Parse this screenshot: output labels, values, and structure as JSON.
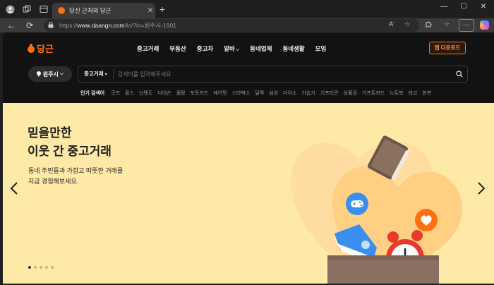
{
  "browser": {
    "tab_title": "당신 근처의 당근",
    "url_scheme": "https://",
    "url_host": "www.daangn.com",
    "url_path": "/kr/?in=원주시-1901",
    "newtab_glyph": "+",
    "back_glyph": "←",
    "reload_glyph": "⟳",
    "minimize_glyph": "—",
    "maximize_glyph": "☐",
    "close_glyph": "✕",
    "more_glyph": "···"
  },
  "header": {
    "logo_text": "당근",
    "nav": [
      {
        "label": "중고거래"
      },
      {
        "label": "부동산"
      },
      {
        "label": "중고차"
      },
      {
        "label": "알바"
      },
      {
        "label": "동네업체"
      },
      {
        "label": "동네생활"
      },
      {
        "label": "모임"
      }
    ],
    "app_download": "앱 다운로드"
  },
  "location": {
    "label": "원주시"
  },
  "search": {
    "category": "중고거래",
    "placeholder": "검색어를 입력해주세요"
  },
  "popular": {
    "label": "인기 검색어",
    "keywords": [
      "굿즈",
      "플스",
      "닌텐도",
      "다이슨",
      "캠핑",
      "포토카드",
      "에어팟",
      "스타벅스",
      "달력",
      "삼성",
      "다이소",
      "가습기",
      "기프티콘",
      "상품권",
      "기프트카드",
      "노트북",
      "레고",
      "한복"
    ]
  },
  "hero": {
    "title_line1": "믿을만한",
    "title_line2": "이웃 간 중고거래",
    "desc_line1": "동네 주민들과 가깝고 따뜻한 거래를",
    "desc_line2": "지금 경험해보세요.",
    "prev_glyph": "‹",
    "next_glyph": "›",
    "slide_count": 5,
    "active_slide": 1
  },
  "colors": {
    "brand": "#ff6f0f",
    "hero_bg": "#ffe9a6",
    "page_bg": "#121212"
  }
}
